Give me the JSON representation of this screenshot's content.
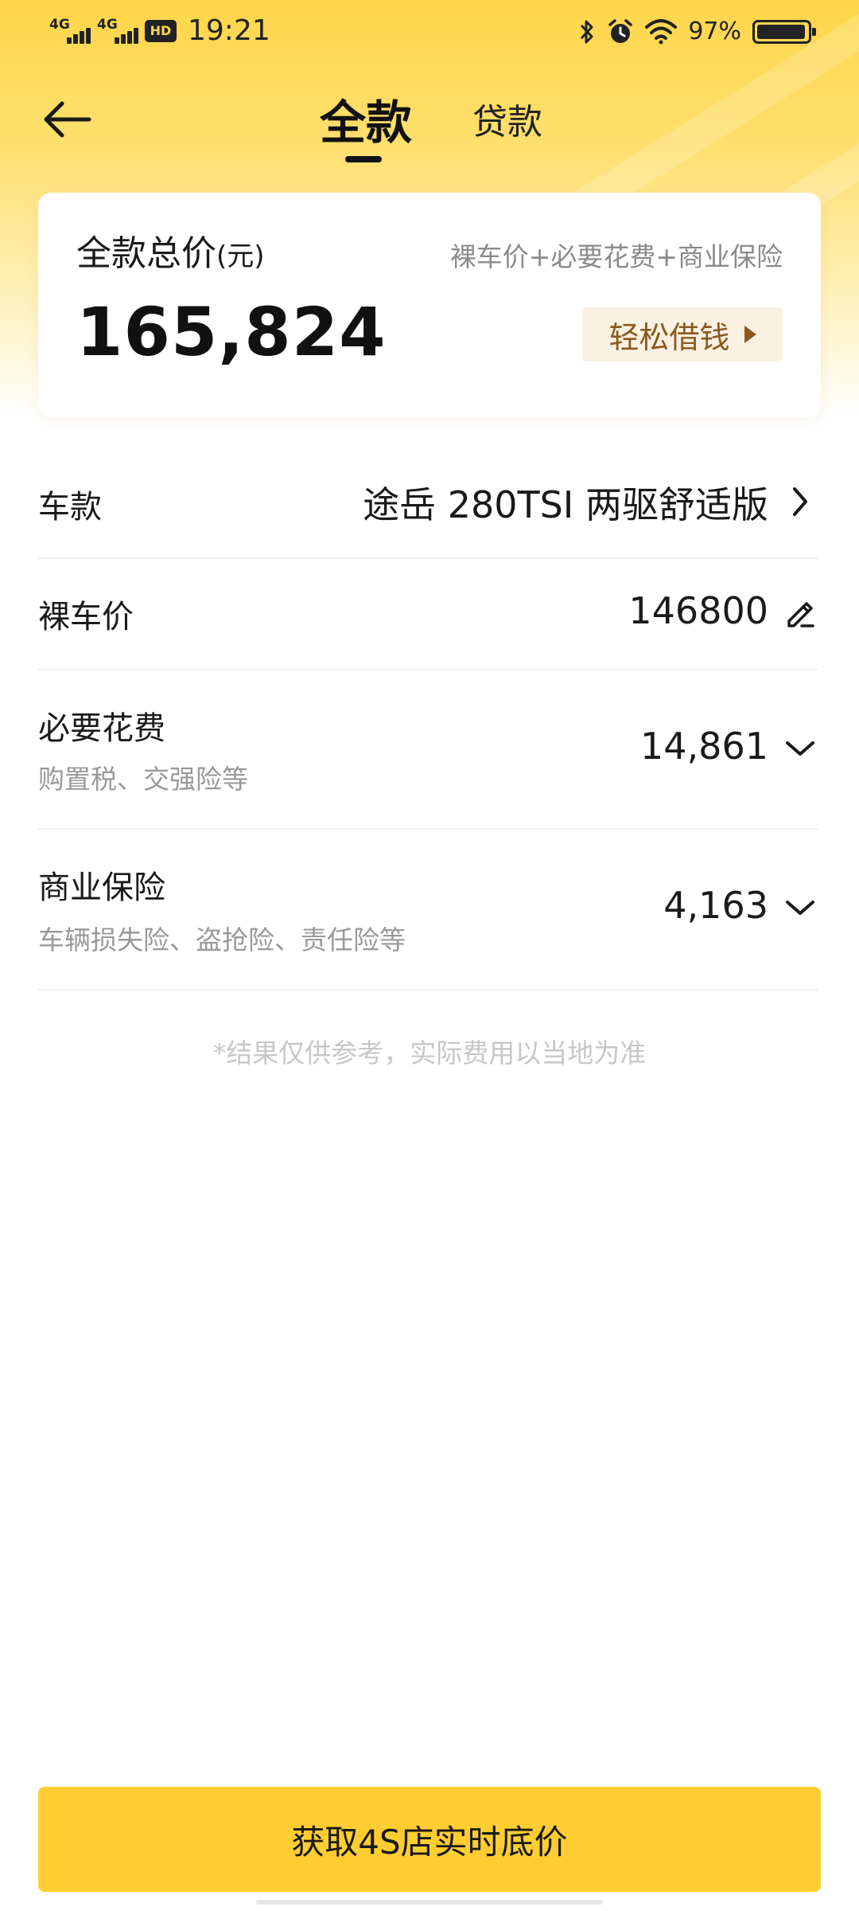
{
  "status_bar": {
    "signal_1_label": "4G",
    "signal_2_label": "4G",
    "hd_label": "HD",
    "time": "19:21",
    "battery_percent": "97%",
    "battery_level": 0.97,
    "icons": [
      "signal-icon",
      "signal-icon",
      "hd-icon",
      "bluetooth-icon",
      "alarm-icon",
      "wifi-icon",
      "battery-icon"
    ]
  },
  "nav": {
    "tabs": [
      {
        "label": "全款",
        "active": true
      },
      {
        "label": "贷款",
        "active": false
      }
    ]
  },
  "summary": {
    "title": "全款总价",
    "unit": "(元)",
    "hint": "裸车价+必要花费+商业保险",
    "total": "165,824",
    "loan_button": "轻松借钱"
  },
  "rows": {
    "model": {
      "label": "车款",
      "value": "途岳 280TSI 两驱舒适版"
    },
    "base_price": {
      "label": "裸车价",
      "value": "146800"
    },
    "required_fees": {
      "label": "必要花费",
      "sub": "购置税、交强险等",
      "value": "14,861"
    },
    "commercial_insurance": {
      "label": "商业保险",
      "sub": "车辆损失险、盗抢险、责任险等",
      "value": "4,163"
    }
  },
  "disclaimer": "*结果仅供参考，实际费用以当地为准",
  "cta_label": "获取4S店实时底价",
  "colors": {
    "accent_yellow": "#ffcd32",
    "loan_button_bg": "#faf1e3",
    "loan_button_text": "#8a5a1e"
  }
}
